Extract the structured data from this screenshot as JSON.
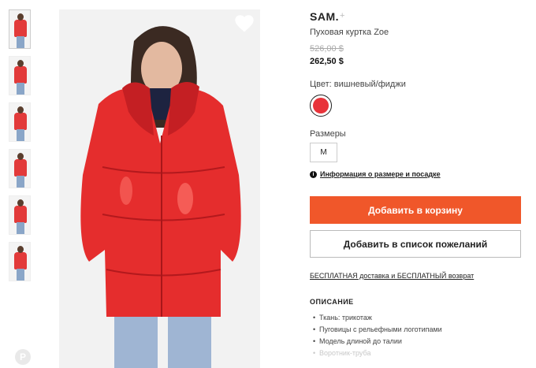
{
  "product": {
    "brand": "SAM.",
    "brand_plus": "+",
    "name": "Пуховая куртка Zoe",
    "old_price": "526,00 $",
    "new_price": "262,50 $",
    "color_label": "Цвет: вишневый/фиджи",
    "sizes_label": "Размеры",
    "size": "M",
    "size_info_icon": "i",
    "size_info_link": "Информация о размере и посадке",
    "add_to_cart": "Добавить в корзину",
    "add_to_wishlist": "Добавить в список пожеланий",
    "free_shipping": "БЕСПЛАТНАЯ доставка и БЕСПЛАТНЫЙ возврат",
    "description_title": "ОПИСАНИЕ",
    "description_items": [
      "Ткань: трикотаж",
      "Пуговицы с рельефными логотипами",
      "Модель длиной до талии",
      "Воротник-труба"
    ],
    "pin_label": "P"
  },
  "colors": {
    "accent": "#f0572a",
    "swatch": "#e8333a",
    "coat": "#e52d2d"
  },
  "icons": {
    "favorite": "heart-icon",
    "info": "info-icon",
    "share": "pinterest-icon"
  }
}
